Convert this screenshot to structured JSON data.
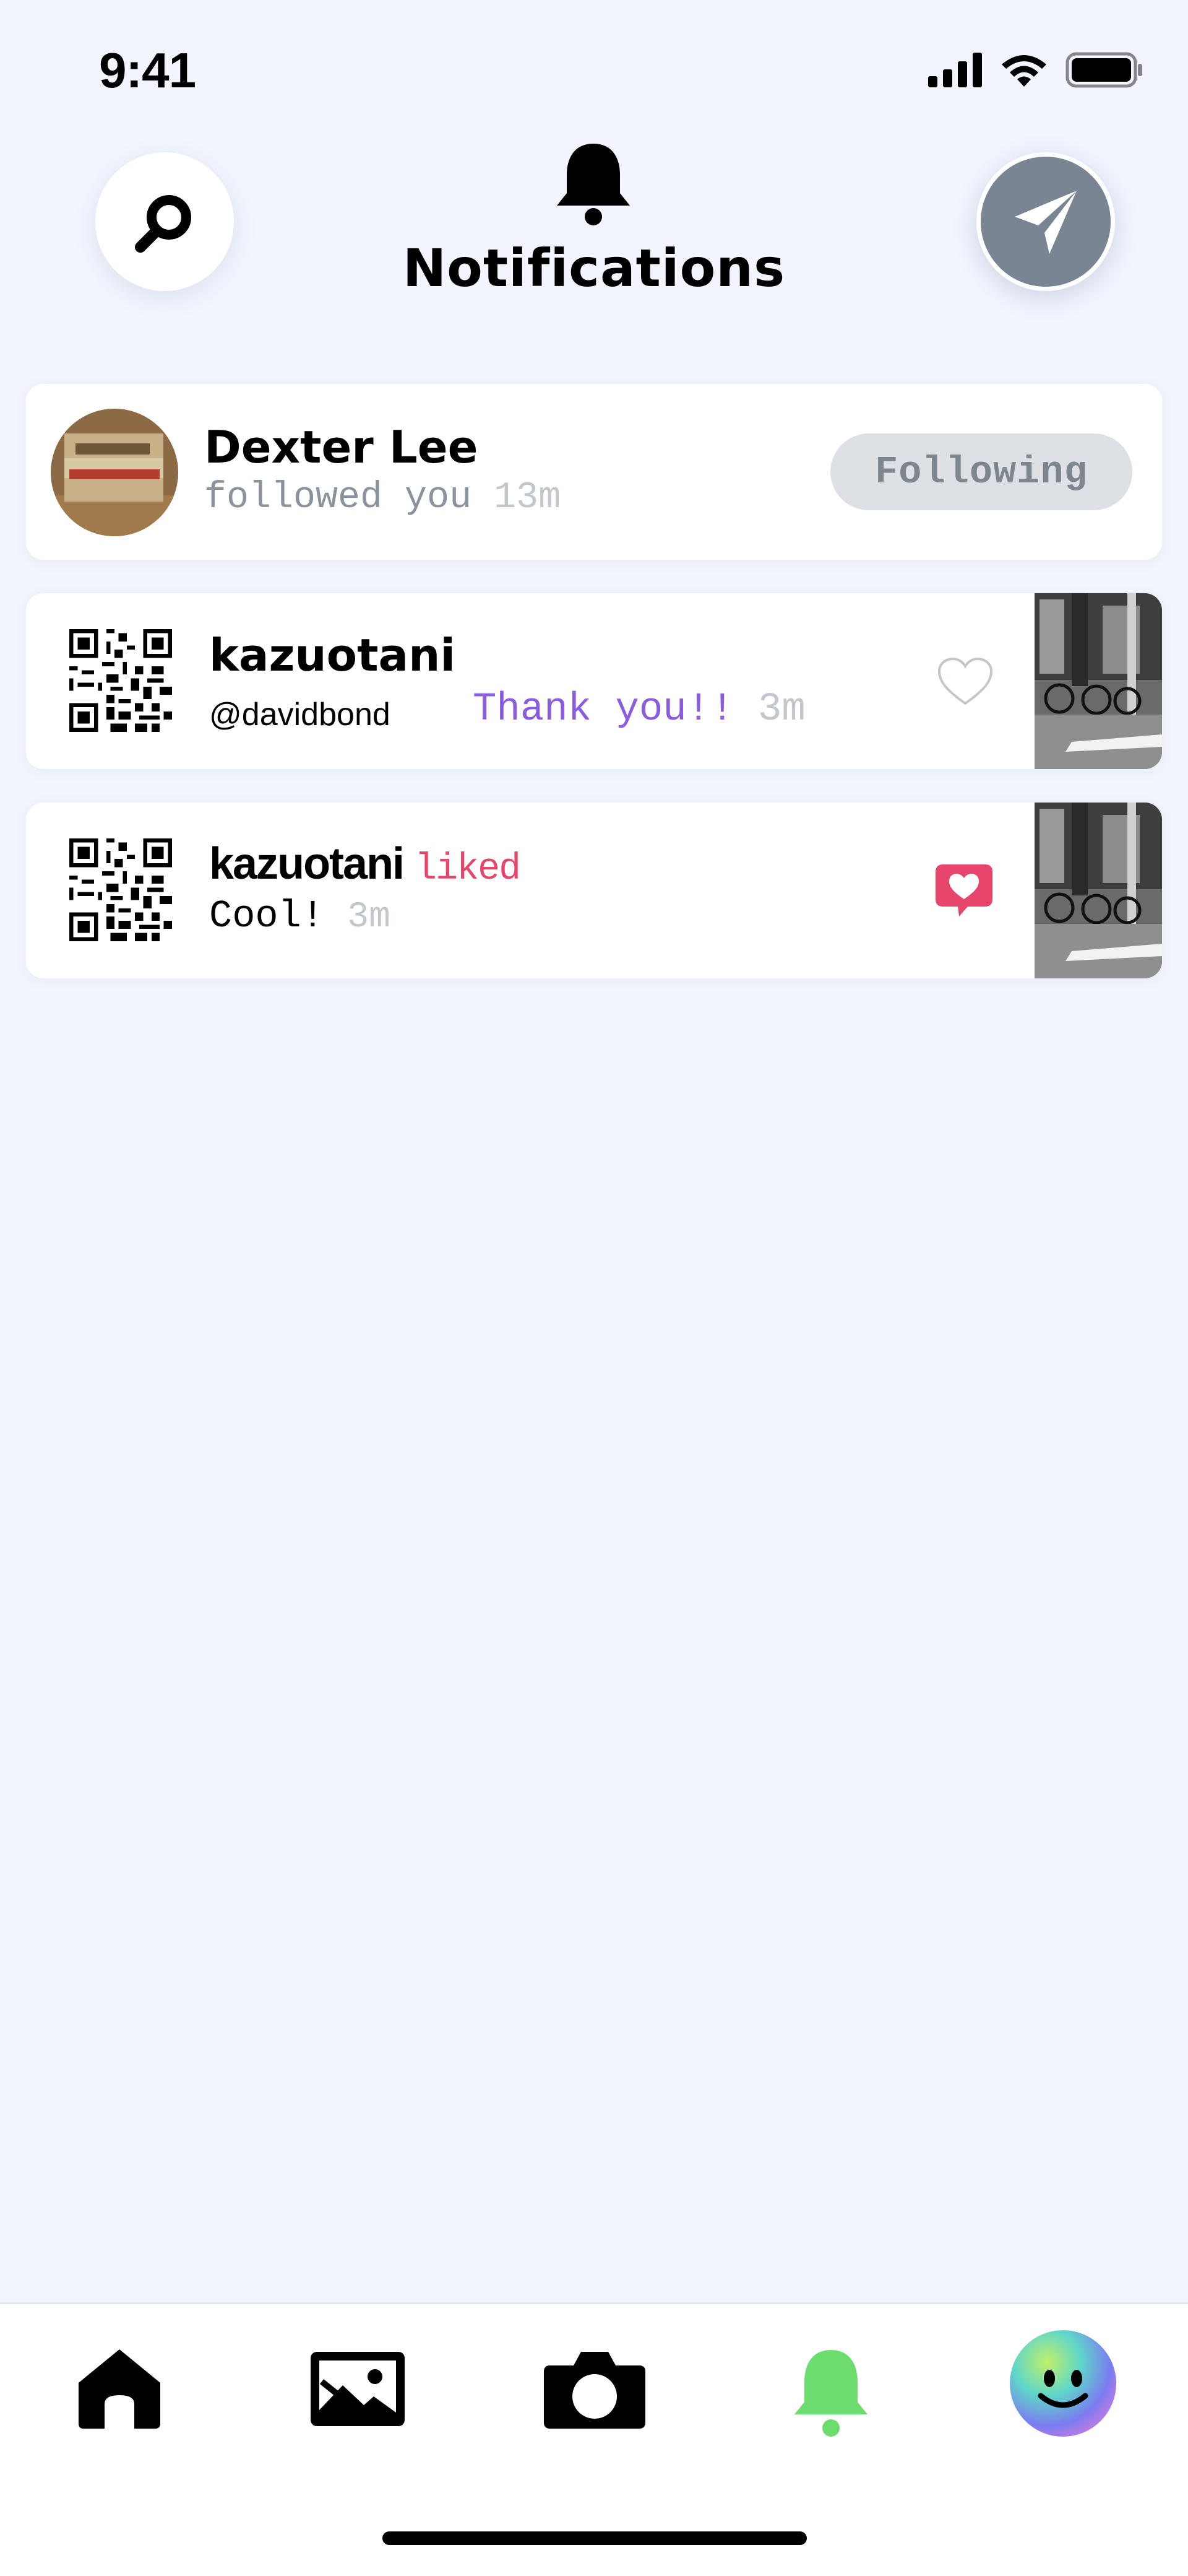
{
  "status_bar": {
    "time": "9:41"
  },
  "header": {
    "title": "Notifications"
  },
  "notifications": [
    {
      "name": "Dexter Lee",
      "action": "followed you",
      "time": "13m",
      "button": "Following"
    },
    {
      "name": "kazuotani",
      "handle": "@davidbond",
      "message": "Thank you!!",
      "time": "3m"
    },
    {
      "name": "kazuotani",
      "action": "liked",
      "message": "Cool!",
      "time": "3m"
    }
  ],
  "tabs": [
    "home-icon",
    "gallery-icon",
    "camera-icon",
    "bell-icon",
    "profile-avatar-icon"
  ],
  "colors": {
    "active_tab": "#6ddc6e",
    "like": "#e8456c",
    "message": "#8a5de0",
    "background": "#f2f5fd"
  }
}
